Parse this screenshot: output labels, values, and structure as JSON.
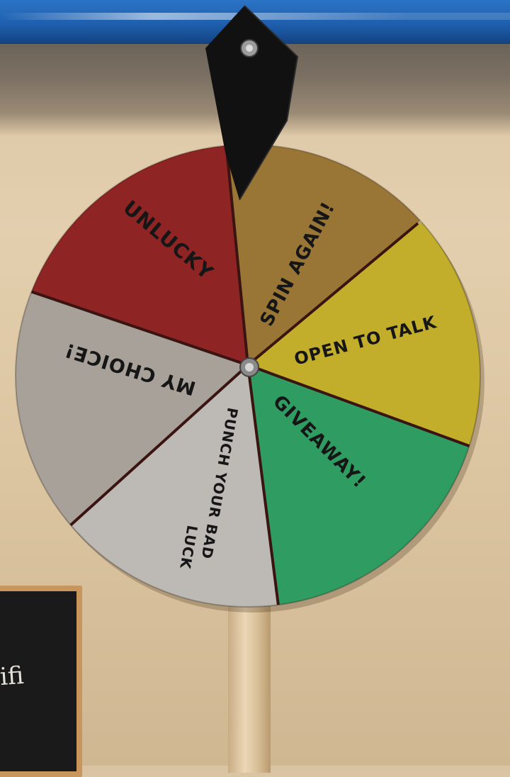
{
  "wheel": {
    "segments": [
      {
        "label": "UNLUCKY",
        "color": "#8f2424"
      },
      {
        "label": "SPIN AGAIN!",
        "color": "#9a7636"
      },
      {
        "label": "OPEN TO TALK",
        "color": "#c2ae2a"
      },
      {
        "label": "GIVEAWAY!",
        "color": "#2f9d62"
      },
      {
        "label": "PUNCH YOUR BAD",
        "color": "#bdbab6"
      },
      {
        "label": "LUCK",
        "color": "#bdbab6"
      },
      {
        "label": "MY CHOICE!",
        "color": "#a8a19a"
      }
    ],
    "divider_color": "#3a1410"
  },
  "chalkboard": {
    "text": "ifi"
  },
  "colors": {
    "rail": "#1e5fae",
    "wall": "#dcc5a1",
    "pointer": "#111111",
    "pole": "#e2cba6"
  }
}
